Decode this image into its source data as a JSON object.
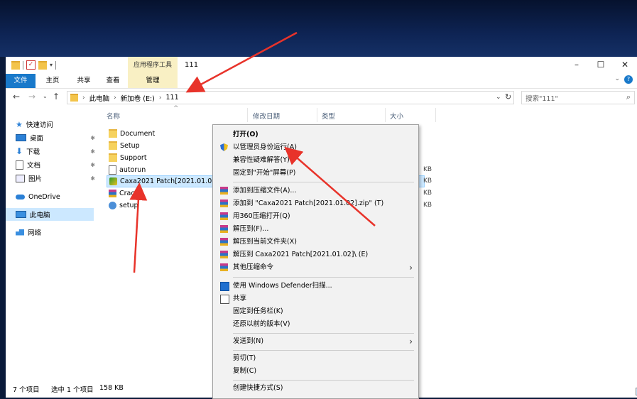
{
  "window": {
    "title": "111",
    "ribbon_context_label": "应用程序工具",
    "controls": {
      "minimize": "–",
      "maximize": "☐",
      "close": "✕"
    }
  },
  "ribbon": {
    "tabs": [
      "文件",
      "主页",
      "共享",
      "查看",
      "管理"
    ],
    "expand_label": "⌄",
    "help_label": "?"
  },
  "address": {
    "path": [
      "此电脑",
      "新加卷 (E:)",
      "111"
    ],
    "search_placeholder": "搜索\"111\""
  },
  "sidebar": {
    "items": [
      {
        "label": "快速访问",
        "icon": "star-icon"
      },
      {
        "label": "桌面",
        "icon": "desktop-icon",
        "pinned": true
      },
      {
        "label": "下载",
        "icon": "download-icon",
        "pinned": true
      },
      {
        "label": "文档",
        "icon": "document-icon",
        "pinned": true
      },
      {
        "label": "图片",
        "icon": "pictures-icon",
        "pinned": true
      },
      {
        "label": "OneDrive",
        "icon": "cloud-icon"
      },
      {
        "label": "此电脑",
        "icon": "pc-icon",
        "selected": true
      },
      {
        "label": "网络",
        "icon": "network-icon"
      }
    ]
  },
  "columns": [
    "名称",
    "修改日期",
    "类型",
    "大小"
  ],
  "files": [
    {
      "name": "Document",
      "icon": "folder-icon",
      "size": ""
    },
    {
      "name": "Setup",
      "icon": "folder-icon",
      "size": ""
    },
    {
      "name": "Support",
      "icon": "folder-icon",
      "size": ""
    },
    {
      "name": "autorun",
      "icon": "file-icon",
      "size": "KB"
    },
    {
      "name": "Caxa2021 Patch[2021.01.02]",
      "icon": "app-icon",
      "size": "KB",
      "selected": true
    },
    {
      "name": "Crack",
      "icon": "rar-icon",
      "size": "KB"
    },
    {
      "name": "setup",
      "icon": "setup-icon",
      "size": "KB"
    }
  ],
  "status": {
    "count": "7 个项目",
    "selected": "选中 1 个项目",
    "size": "158 KB"
  },
  "context_menu": {
    "items": [
      {
        "label": "打开(O)",
        "bold": true
      },
      {
        "label": "以管理员身份运行(A)",
        "icon": "uac-shield-icon"
      },
      {
        "label": "兼容性疑难解答(Y)"
      },
      {
        "label": "固定到\"开始\"屏幕(P)"
      },
      {
        "label": "添加到压缩文件(A)...",
        "icon": "winrar-icon"
      },
      {
        "label": "添加到 \"Caxa2021 Patch[2021.01.02].zip\" (T)",
        "icon": "winrar-icon"
      },
      {
        "label": "用360压缩打开(Q)",
        "icon": "winrar-icon"
      },
      {
        "label": "解压到(F)...",
        "icon": "winrar-icon"
      },
      {
        "label": "解压到当前文件夹(X)",
        "icon": "winrar-icon"
      },
      {
        "label": "解压到 Caxa2021 Patch[2021.01.02]\\ (E)",
        "icon": "winrar-icon"
      },
      {
        "label": "其他压缩命令",
        "icon": "winrar-icon",
        "submenu": true
      },
      {
        "label": "使用 Windows Defender扫描...",
        "icon": "defender-icon"
      },
      {
        "label": "共享",
        "icon": "share-icon"
      },
      {
        "label": "固定到任务栏(K)"
      },
      {
        "label": "还原以前的版本(V)"
      },
      {
        "label": "发送到(N)",
        "submenu": true
      },
      {
        "label": "剪切(T)"
      },
      {
        "label": "复制(C)"
      },
      {
        "label": "创建快捷方式(S)"
      }
    ]
  }
}
